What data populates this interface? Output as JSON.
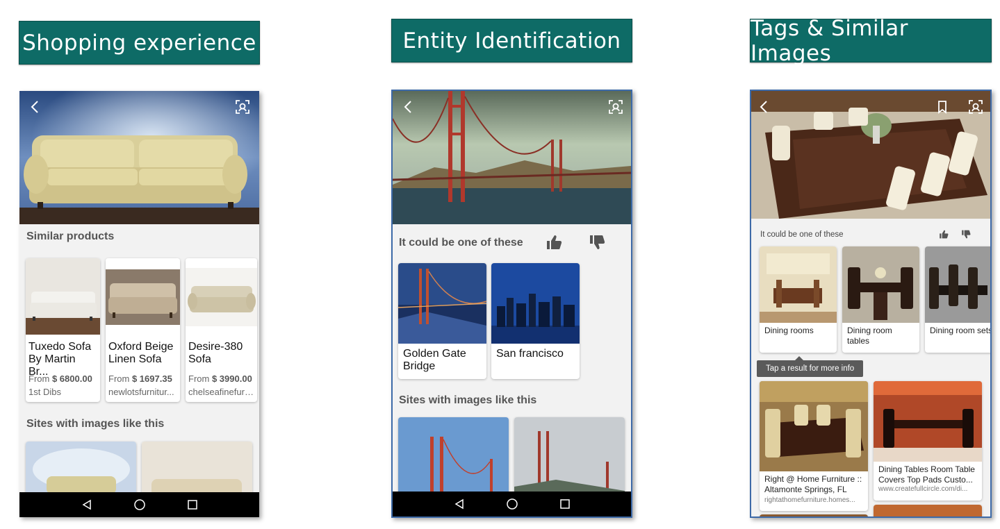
{
  "banners": {
    "shopping": "Shopping experience",
    "entity": "Entity Identification",
    "tags": "Tags & Similar Images"
  },
  "icons": {
    "back": "chevron-left-icon",
    "visual_search": "camera-scan-icon",
    "bookmark": "bookmark-icon",
    "thumbs_up": "thumbs-up-icon",
    "thumbs_down": "thumbs-down-icon",
    "nav_back": "triangle-back-icon",
    "nav_home": "circle-home-icon",
    "nav_recent": "square-recent-icon"
  },
  "colors": {
    "banner_bg": "#0e6b66",
    "phone_border": "#3d6aa8"
  },
  "shopping": {
    "similar_products_title": "Similar products",
    "products": [
      {
        "name": "Tuxedo Sofa By Martin Br...",
        "price_prefix": "From",
        "price": "$ 6800.00",
        "site": "1st Dibs"
      },
      {
        "name": "Oxford Beige Linen Sofa",
        "price_prefix": "From",
        "price": "$ 1697.35",
        "site": "newlotsfurnitur..."
      },
      {
        "name": "Desire-380 Sofa",
        "price_prefix": "From",
        "price": "$ 3990.00",
        "site": "chelseafinefurn..."
      }
    ],
    "sites_title": "Sites with images like this"
  },
  "entity": {
    "could_be_title": "It could be one of these",
    "entities": [
      {
        "name": "Golden Gate Bridge"
      },
      {
        "name": "San francisco"
      }
    ],
    "sites_title": "Sites with images like this"
  },
  "tags": {
    "could_be_title": "It could be one of these",
    "tags": [
      {
        "name": "Dining rooms"
      },
      {
        "name": "Dining room tables"
      },
      {
        "name": "Dining room sets"
      }
    ],
    "tooltip": "Tap a result for more info",
    "results": [
      {
        "title": "Right @ Home Furniture :: Altamonte Springs, FL",
        "site": "rightathomefurniture.homes..."
      },
      {
        "title": "Dining Tables Room Table Covers Top Pads Custo...",
        "site": "www.createfullcircle.com/di..."
      }
    ]
  }
}
